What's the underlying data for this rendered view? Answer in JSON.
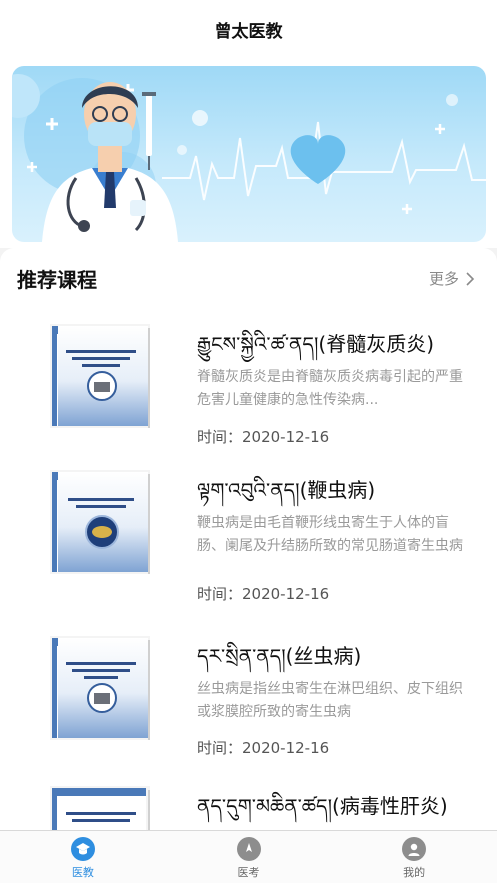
{
  "header": {
    "title": "曾太医教"
  },
  "banner": {
    "illustration": "doctor-with-syringe-and-heartbeat"
  },
  "section": {
    "title": "推荐课程",
    "more_label": "更多"
  },
  "courses": [
    {
      "title": "རྒྱུངས་སྐྱིའི་ཚ་ནད།(脊髓灰质炎)",
      "desc": "脊髓灰质炎是由脊髓灰质炎病毒引起的严重危害儿童健康的急性传染病...",
      "date": "时间：2020-12-16"
    },
    {
      "title": "ལྟག་འབུའི་ནད།(鞭虫病)",
      "desc": "鞭虫病是由毛首鞭形线虫寄生于人体的盲肠、阑尾及升结肠所致的常见肠道寄生虫病",
      "date": "时间：2020-12-16"
    },
    {
      "title": "དར་སྲིན་ནད།(丝虫病)",
      "desc": "丝虫病是指丝虫寄生在淋巴组织、皮下组织或浆膜腔所致的寄生虫病",
      "date": "时间：2020-12-16"
    },
    {
      "title": "ནད་དུག་མཆིན་ཚད།(病毒性肝炎)",
      "desc": "",
      "date": ""
    }
  ],
  "tabs": [
    {
      "label": "医教",
      "icon": "graduation-cap-icon",
      "active": true
    },
    {
      "label": "医考",
      "icon": "compass-icon",
      "active": false
    },
    {
      "label": "我的",
      "icon": "user-icon",
      "active": false
    }
  ],
  "colors": {
    "accent": "#2e8ee0",
    "banner": "#b3e2f9"
  }
}
